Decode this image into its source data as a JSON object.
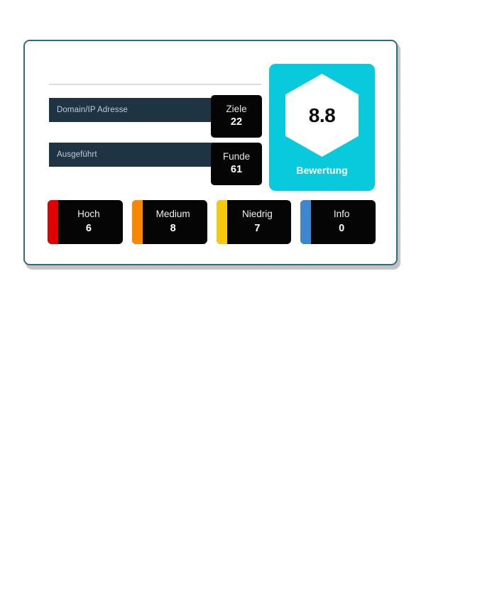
{
  "card": {
    "border_color": "#2f6b80",
    "background": "#ffffff"
  },
  "form": {
    "fields": [
      {
        "name": "domain-ip",
        "placeholder": "Domain/IP Adresse",
        "value": ""
      },
      {
        "name": "executed",
        "placeholder": "Ausgeführt",
        "value": ""
      }
    ]
  },
  "stats": [
    {
      "label": "Ziele",
      "value": "22"
    },
    {
      "label": "Funde",
      "value": "61"
    }
  ],
  "rating": {
    "score": "8.8",
    "label": "Bewertung",
    "accent_color": "#09c9dc"
  },
  "severities": [
    {
      "label": "Hoch",
      "count": "6",
      "color": "#e00000"
    },
    {
      "label": "Medium",
      "count": "8",
      "color": "#f98700"
    },
    {
      "label": "Niedrig",
      "count": "7",
      "color": "#f9c80e"
    },
    {
      "label": "Info",
      "count": "0",
      "color": "#3c87ce"
    }
  ]
}
